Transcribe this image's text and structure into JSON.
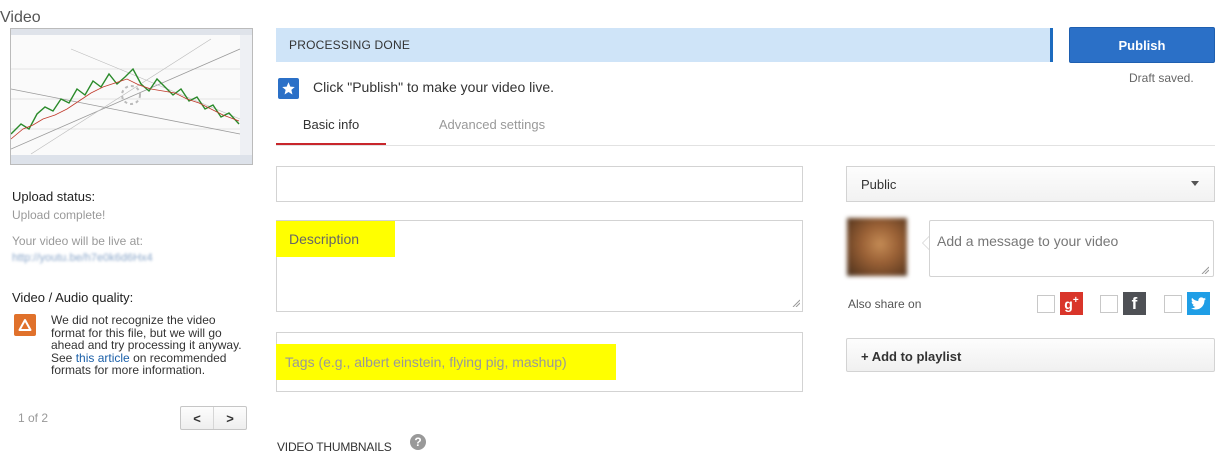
{
  "left": {
    "upload_status_title": "Upload status:",
    "upload_status_value": "Upload complete!",
    "live_at_label": "Your video will be live at:",
    "video_url": "http://youtu.be/h7e0k6d6Hx4",
    "quality_title": "Video / Audio quality:",
    "quality_message_1": "We did not recognize the video format for this file, but we will go ahead and try processing it anyway. See",
    "quality_link": "this article",
    "quality_message_2": "on recommended formats for more information.",
    "pager_count": "1 of 2",
    "pager_prev": "<",
    "pager_next": ">"
  },
  "status": {
    "text": "PROCESSING DONE",
    "publish_label": "Publish",
    "draft_saved": "Draft saved.",
    "publish_hint": "Click \"Publish\" to make your video live."
  },
  "tabs": [
    {
      "label": "Basic info",
      "active": true
    },
    {
      "label": "Advanced settings",
      "active": false
    }
  ],
  "form": {
    "title_value": "Video",
    "description_value": "Description",
    "tags_placeholder": "Tags (e.g., albert einstein, flying pig, mashup)",
    "privacy_value": "Public",
    "message_placeholder": "Add a message to your video",
    "also_share_label": "Also share on",
    "add_to_playlist_label": "+ Add to playlist",
    "thumbnails_title": "VIDEO THUMBNAILS",
    "help_glyph": "?"
  },
  "share_icons": [
    "google-plus-icon",
    "facebook-icon",
    "twitter-icon"
  ],
  "colors": {
    "accent_blue": "#2b70c7",
    "status_bar_bg": "#cfe4f8",
    "active_tab_underline": "#c8262b",
    "highlight_yellow": "#ffff00",
    "warning_orange": "#e0712b"
  }
}
